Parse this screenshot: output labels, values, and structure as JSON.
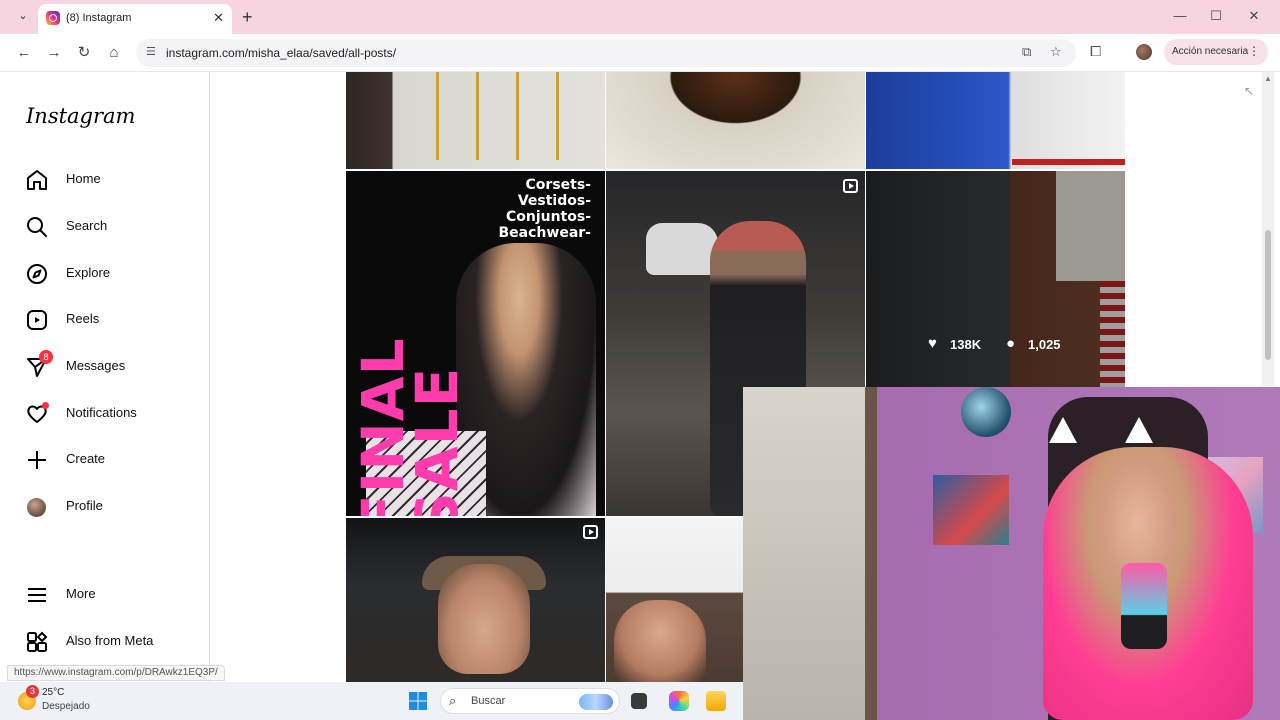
{
  "browser": {
    "tab_title": "(8) Instagram",
    "tab_close": "✕",
    "new_tab": "+",
    "url": "instagram.com/misha_elaa/saved/all-posts/",
    "action_label": "Acción necesaria",
    "status_url": "https://www.instagram.com/p/DRAwkz1EQ3P/"
  },
  "sidebar": {
    "logo": "Instagram",
    "items": [
      {
        "label": "Home",
        "icon": "home-icon"
      },
      {
        "label": "Search",
        "icon": "search-icon"
      },
      {
        "label": "Explore",
        "icon": "compass-icon"
      },
      {
        "label": "Reels",
        "icon": "reels-icon"
      },
      {
        "label": "Messages",
        "icon": "messenger-icon",
        "badge": "8"
      },
      {
        "label": "Notifications",
        "icon": "heart-icon"
      },
      {
        "label": "Create",
        "icon": "plus-icon"
      },
      {
        "label": "Profile",
        "icon": "avatar"
      },
      {
        "label": "More",
        "icon": "menu-icon"
      },
      {
        "label": "Also from Meta",
        "icon": "meta-grid-icon"
      }
    ]
  },
  "grid": {
    "sale_post": {
      "headline": "FINAL SALE",
      "categories": [
        "Corsets-",
        "Vestidos-",
        "Conjuntos-",
        "Beachwear-"
      ]
    },
    "hover_stats": {
      "likes": "138K",
      "comments": "1,025"
    }
  },
  "taskbar": {
    "weather_badge": "3",
    "temperature": "25°C",
    "condition": "Despejado",
    "search_label": "Buscar"
  }
}
